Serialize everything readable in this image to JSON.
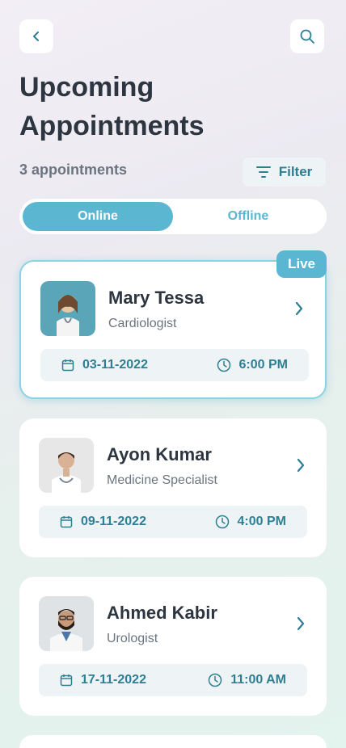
{
  "header": {
    "title": "Upcoming Appointments",
    "count_text": "3 appointments",
    "filter_label": "Filter"
  },
  "toggle": {
    "options": [
      "Online",
      "Offline"
    ],
    "selected": "Online"
  },
  "appointments": [
    {
      "name": "Mary Tessa",
      "specialty": "Cardiologist",
      "date": "03-11-2022",
      "time": "6:00 PM",
      "live": true,
      "badge": "Live"
    },
    {
      "name": "Ayon Kumar",
      "specialty": "Medicine Specialist",
      "date": "09-11-2022",
      "time": "4:00 PM",
      "live": false
    },
    {
      "name": "Ahmed Kabir",
      "specialty": "Urologist",
      "date": "17-11-2022",
      "time": "11:00 AM",
      "live": false
    }
  ],
  "icons": {
    "back": "chevron-left-icon",
    "search": "search-icon",
    "filter": "filter-lines-icon",
    "open": "chevron-right-icon",
    "date": "calendar-icon",
    "time": "clock-icon"
  },
  "colors": {
    "accent": "#5bb7d1",
    "accent_dark": "#2e7f93",
    "text_dark": "#2d3640",
    "text_muted": "#6b7580"
  }
}
